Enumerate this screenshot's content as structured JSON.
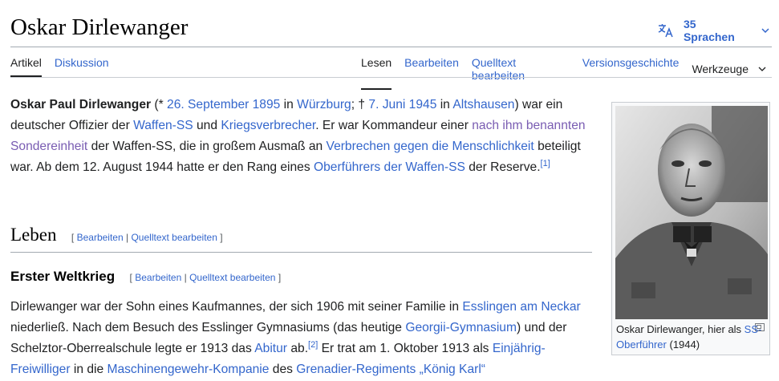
{
  "page": {
    "title": "Oskar Dirlewanger",
    "languages_label": "35 Sprachen"
  },
  "tabs_left": [
    "Artikel",
    "Diskussion"
  ],
  "tabs_right": [
    "Lesen",
    "Bearbeiten",
    "Quelltext bearbeiten",
    "Versionsgeschichte",
    "Werkzeuge"
  ],
  "intro": {
    "name": "Oskar Paul Dirlewanger",
    "t1": " (* ",
    "birth_date": "26. September 1895",
    "t2": " in ",
    "birth_place": "Würzburg",
    "t3": "; † ",
    "death_date": "7. Juni 1945",
    "t4": " in ",
    "death_place": "Altshausen",
    "t5": ") war ein deutscher Offizier der ",
    "link_waffen_ss": "Waffen-SS",
    "t6": " und ",
    "link_kriegsverbrecher": "Kriegsverbrecher",
    "t7": ". Er war Kommandeur einer ",
    "link_sondereinheit": "nach ihm benannten Sondereinheit",
    "t8": " der Waffen-SS, die in großem Ausmaß an ",
    "link_verbrechen": "Verbrechen gegen die Menschlichkeit",
    "t9": " beteiligt war. Ab dem 12. August 1944 hatte er den Rang eines ",
    "link_oberfuehrer": "Oberführers der Waffen-SS",
    "t10": " der Reserve.",
    "ref1": "[1]"
  },
  "section_leben": {
    "heading": "Leben",
    "bracket_open": "[",
    "edit": "Bearbeiten",
    "sep": "|",
    "source_edit": "Quelltext bearbeiten",
    "bracket_close": "]"
  },
  "section_weltkrieg": {
    "heading": "Erster Weltkrieg",
    "bracket_open": "[",
    "edit": "Bearbeiten",
    "sep": "|",
    "source_edit": "Quelltext bearbeiten",
    "bracket_close": "]"
  },
  "para2": {
    "t1": "Dirlewanger war der Sohn eines Kaufmannes, der sich 1906 mit seiner Familie in ",
    "link_esslingen": "Esslingen am Neckar",
    "t2": " niederließ. Nach dem Besuch des Esslinger Gymnasiums (das heutige ",
    "link_georgii": "Georgii-Gymnasium",
    "t3": ") und der Schelztor-Oberrealschule legte er 1913 das ",
    "link_abitur": "Abitur",
    "t4": " ab.",
    "ref2": "[2]",
    "t5": " Er trat am 1. Oktober 1913 als ",
    "link_einjaehrig": "Einjährig-Freiwilliger",
    "t6": " in die ",
    "link_mg": "Maschinengewehr-Kompanie",
    "t7": " des ",
    "link_grenadier": "Grenadier-Regiments „König Karl“"
  },
  "infobox": {
    "caption_t1": "Oskar Dirlewanger, hier als ",
    "caption_link": "SS-Oberführer",
    "caption_t2": " (1944)"
  }
}
